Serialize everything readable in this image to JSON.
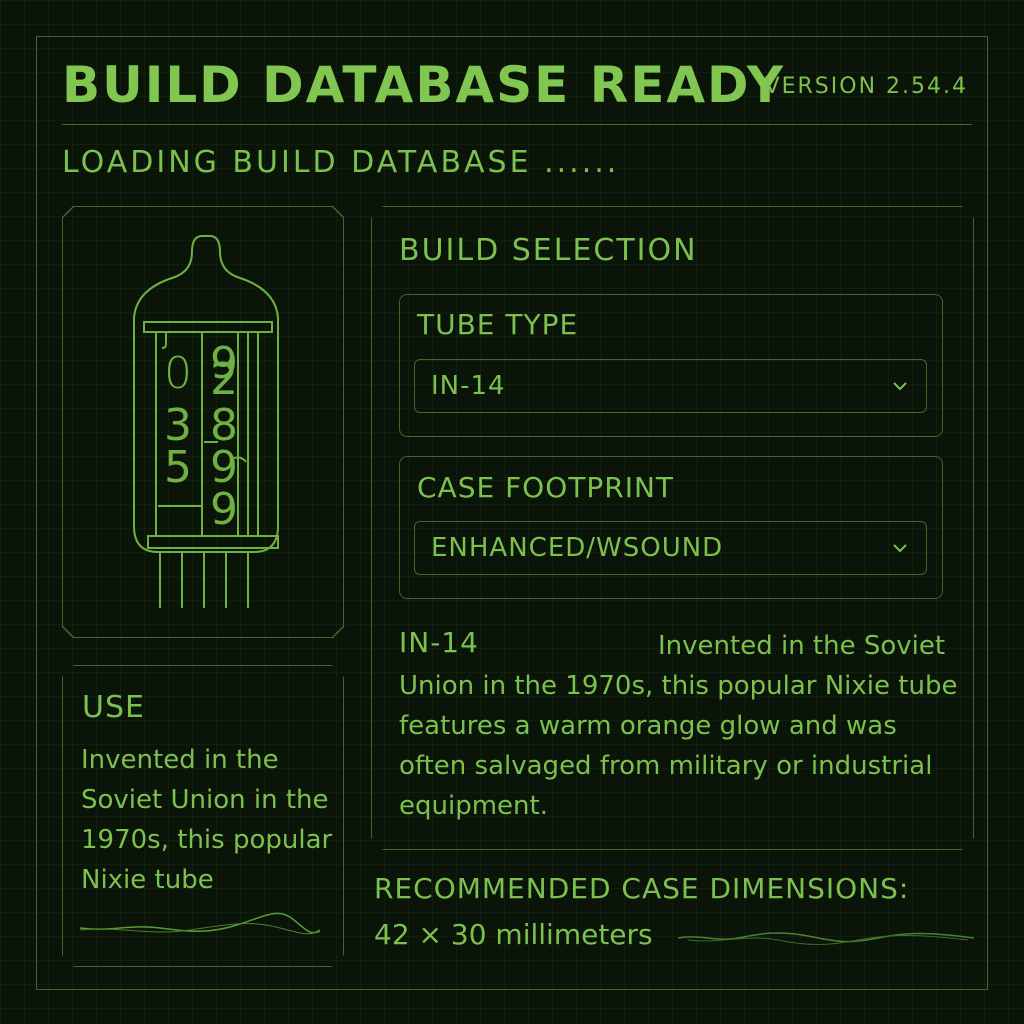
{
  "header": {
    "title": "BUILD DATABASE READY",
    "version": "VERSION 2.54.4",
    "loading": "LOADING BUILD DATABASE ......"
  },
  "tube_illustration": {
    "icon": "nixie-tube-icon",
    "left_digits": [
      "0",
      "3",
      "5"
    ],
    "right_digits": [
      "9",
      "2",
      "8",
      "9",
      "9"
    ]
  },
  "use_panel": {
    "heading": "USE",
    "text": "Invented in the Soviet Union in the 1970s, this popular Nixie tube"
  },
  "build_selection": {
    "heading": "BUILD SELECTION",
    "tube_type": {
      "label": "TUBE TYPE",
      "value": "IN-14"
    },
    "case_footprint": {
      "label": "CASE FOOTPRINT",
      "value": "ENHANCED/WSOUND"
    },
    "description": {
      "name": "IN-14",
      "text": "Invented in the Soviet Union in the 1970s, this popular Nixie tube features a warm orange glow and was often salvaged from military or industrial equipment."
    }
  },
  "dimensions": {
    "label": "RECOMMENDED CASE DIMENSIONS:",
    "value": "42 × 30 millimeters"
  },
  "colors": {
    "background": "#0a1408",
    "accent": "#7cc04e",
    "border": "#3c6a2a"
  }
}
